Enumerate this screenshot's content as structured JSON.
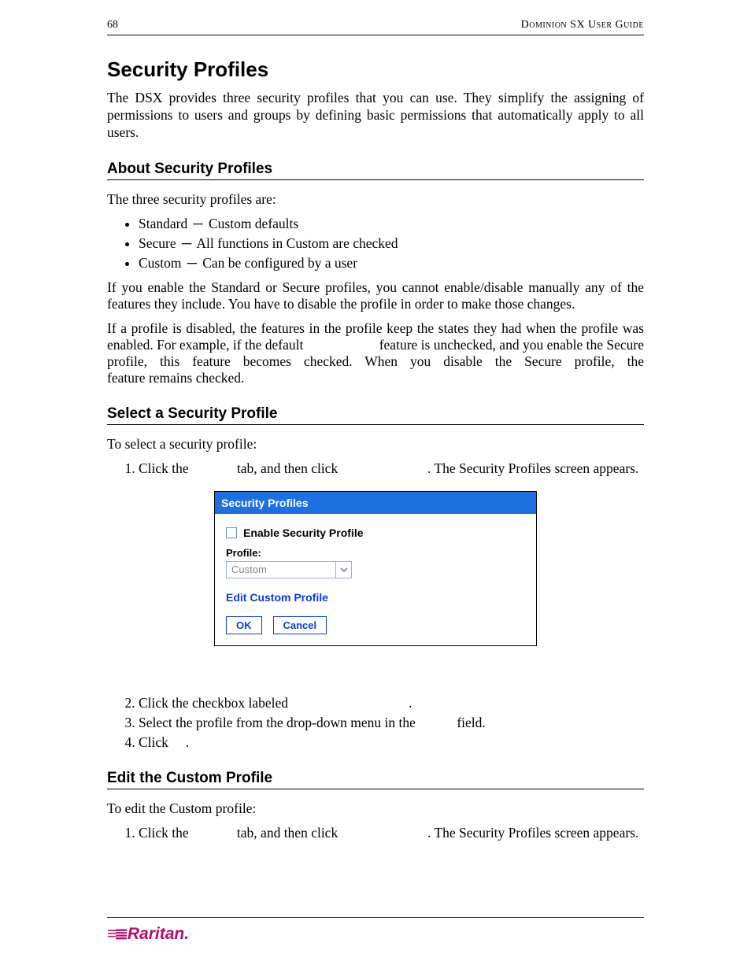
{
  "header": {
    "page_number": "68",
    "guide_title": "Dominion SX User Guide"
  },
  "section": {
    "title": "Security Profiles",
    "intro": "The DSX provides three security profiles that you can use. They simplify the assigning of permissions to users and groups by defining basic permissions that automatically apply to all users."
  },
  "about": {
    "heading": "About Security Profiles",
    "lead": "The three security profiles are:",
    "items": [
      {
        "name": "Standard",
        "desc": "Custom defaults"
      },
      {
        "name": "Secure",
        "desc": "All functions in Custom are checked"
      },
      {
        "name": "Custom",
        "desc": "Can be configured by a user"
      }
    ],
    "para1": "If you enable the Standard or Secure profiles, you cannot enable/disable manually any of the features they include. You have to disable the profile in order to make those changes.",
    "para2": "If a profile is disabled, the features in the profile keep the states they had when the profile was enabled. For example, if the default                      feature is unchecked, and you enable the Secure profile, this feature becomes checked. When you disable the Secure profile, the                      feature remains checked."
  },
  "select": {
    "heading": "Select a Security Profile",
    "lead": "To select a security profile:",
    "steps": [
      "Click the              tab, and then click                          . The Security Profiles screen appears.",
      "Click the checkbox labeled                                   .",
      "Select the profile from the drop-down menu in the            field.",
      "Click     ."
    ]
  },
  "figure": {
    "title": "Security Profiles",
    "checkbox_label": "Enable Security Profile",
    "profile_label": "Profile:",
    "dropdown_value": "Custom",
    "edit_link": "Edit Custom Profile",
    "ok": "OK",
    "cancel": "Cancel"
  },
  "edit": {
    "heading": "Edit the Custom Profile",
    "lead": "To edit the Custom profile:",
    "steps": [
      "Click the              tab, and then click                          . The Security Profiles screen appears."
    ]
  },
  "footer": {
    "brand": "Raritan."
  }
}
